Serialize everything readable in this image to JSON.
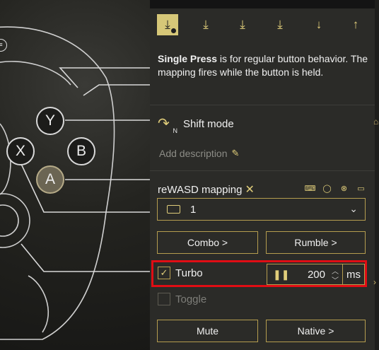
{
  "panel": {
    "toolbar": [
      {
        "name": "single-press",
        "glyph": "⤓",
        "active": true
      },
      {
        "name": "long-press",
        "glyph": "⤓",
        "active": false
      },
      {
        "name": "double-press",
        "glyph": "⤓",
        "active": false
      },
      {
        "name": "triple-press",
        "glyph": "⤓",
        "active": false
      },
      {
        "name": "start-press",
        "glyph": "↓",
        "active": false
      },
      {
        "name": "release",
        "glyph": "↑",
        "active": false
      }
    ],
    "description_bold": "Single Press",
    "description_rest": " is for regular button behavior. The mapping fires while the button is held.",
    "shift_label": "Shift mode",
    "shift_badge": "N",
    "add_description": "Add description",
    "mapping_title": "reWASD mapping",
    "mapping_value": "1",
    "combo_label": "Combo >",
    "rumble_label": "Rumble >",
    "turbo_label": "Turbo",
    "turbo_checked": true,
    "turbo_value": "200",
    "turbo_unit": "ms",
    "toggle_label": "Toggle",
    "mute_label": "Mute",
    "native_label": "Native >"
  },
  "controller": {
    "buttons": {
      "y": "Y",
      "x": "X",
      "b": "B",
      "a": "A"
    },
    "edge_icon": "≡"
  },
  "colors": {
    "accent": "#e0cd7a",
    "border": "#b59d4f",
    "highlight": "#e00d14",
    "panel": "#2b2b28"
  }
}
